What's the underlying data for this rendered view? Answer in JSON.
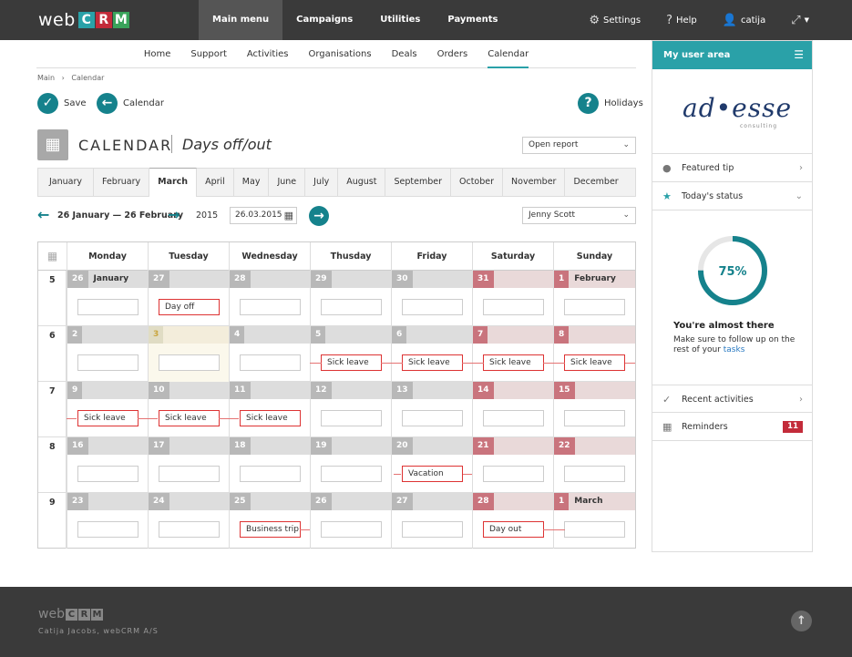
{
  "brand": {
    "prefix": "web",
    "letters": [
      "C",
      "R",
      "M"
    ],
    "letter_colors": [
      "#2aa1a8",
      "#c32b3a",
      "#3aa35b"
    ]
  },
  "topnav": [
    {
      "label": "Main menu",
      "active": true
    },
    {
      "label": "Campaigns",
      "active": false
    },
    {
      "label": "Utilities",
      "active": false
    },
    {
      "label": "Payments",
      "active": false
    }
  ],
  "topright": {
    "settings": "Settings",
    "help": "Help",
    "user": "catija"
  },
  "subnav": [
    "Home",
    "Support",
    "Activities",
    "Organisations",
    "Deals",
    "Orders",
    "Calendar"
  ],
  "subnav_active": "Calendar",
  "breadcrumb": {
    "root": "Main",
    "sep": "›",
    "current": "Calendar"
  },
  "actions": {
    "save": "Save",
    "calendar": "Calendar",
    "holidays": "Holidays"
  },
  "title": {
    "main": "CALENDAR",
    "sub": "Days off/out"
  },
  "open_report": "Open report",
  "months": [
    "January",
    "February",
    "March",
    "April",
    "May",
    "June",
    "July",
    "August",
    "September",
    "October",
    "November",
    "December"
  ],
  "active_month": "March",
  "range": {
    "text": "26 January — 26 February",
    "year": "2015",
    "date": "26.03.2015"
  },
  "person": "Jenny Scott",
  "weekdays": [
    "Monday",
    "Tuesday",
    "Wednesday",
    "Thusday",
    "Friday",
    "Saturday",
    "Sunday"
  ],
  "weeks": [
    {
      "num": "5",
      "days": [
        {
          "d": "26",
          "month": "January",
          "event": ""
        },
        {
          "d": "27",
          "event": "Day off"
        },
        {
          "d": "28",
          "event": ""
        },
        {
          "d": "29",
          "event": ""
        },
        {
          "d": "30",
          "event": ""
        },
        {
          "d": "31",
          "event": ""
        },
        {
          "d": "1",
          "month": "February",
          "event": ""
        }
      ]
    },
    {
      "num": "6",
      "days": [
        {
          "d": "2",
          "event": ""
        },
        {
          "d": "3",
          "event": ""
        },
        {
          "d": "4",
          "event": ""
        },
        {
          "d": "5",
          "event": "Sick leave"
        },
        {
          "d": "6",
          "event": "Sick leave"
        },
        {
          "d": "7",
          "event": "Sick leave"
        },
        {
          "d": "8",
          "event": "Sick leave"
        }
      ]
    },
    {
      "num": "7",
      "days": [
        {
          "d": "9",
          "event": "Sick leave"
        },
        {
          "d": "10",
          "event": "Sick leave"
        },
        {
          "d": "11",
          "event": "Sick leave"
        },
        {
          "d": "12",
          "event": ""
        },
        {
          "d": "13",
          "event": ""
        },
        {
          "d": "14",
          "event": ""
        },
        {
          "d": "15",
          "event": ""
        }
      ]
    },
    {
      "num": "8",
      "days": [
        {
          "d": "16",
          "event": ""
        },
        {
          "d": "17",
          "event": ""
        },
        {
          "d": "18",
          "event": ""
        },
        {
          "d": "19",
          "event": ""
        },
        {
          "d": "20",
          "event": "Vacation"
        },
        {
          "d": "21",
          "event": ""
        },
        {
          "d": "22",
          "event": ""
        }
      ]
    },
    {
      "num": "9",
      "days": [
        {
          "d": "23",
          "event": ""
        },
        {
          "d": "24",
          "event": ""
        },
        {
          "d": "25",
          "event": "Business trip"
        },
        {
          "d": "26",
          "event": ""
        },
        {
          "d": "27",
          "event": ""
        },
        {
          "d": "28",
          "event": "Day out"
        },
        {
          "d": "1",
          "month": "March",
          "event": ""
        }
      ]
    }
  ],
  "sidebar": {
    "title": "My user area",
    "logo_main": "ad•esse",
    "logo_sub": "consulting",
    "featured_tip": "Featured tip",
    "todays_status": "Today's status",
    "progress_percent": 75,
    "progress_label": "75%",
    "almost_title": "You're almost there",
    "almost_text": "Make sure to follow up on the rest of your",
    "almost_link": "tasks",
    "recent": "Recent activities",
    "reminders": "Reminders",
    "reminders_count": "11"
  },
  "footer": {
    "copyright": "Catija Jacobs,  webCRM A/S"
  }
}
